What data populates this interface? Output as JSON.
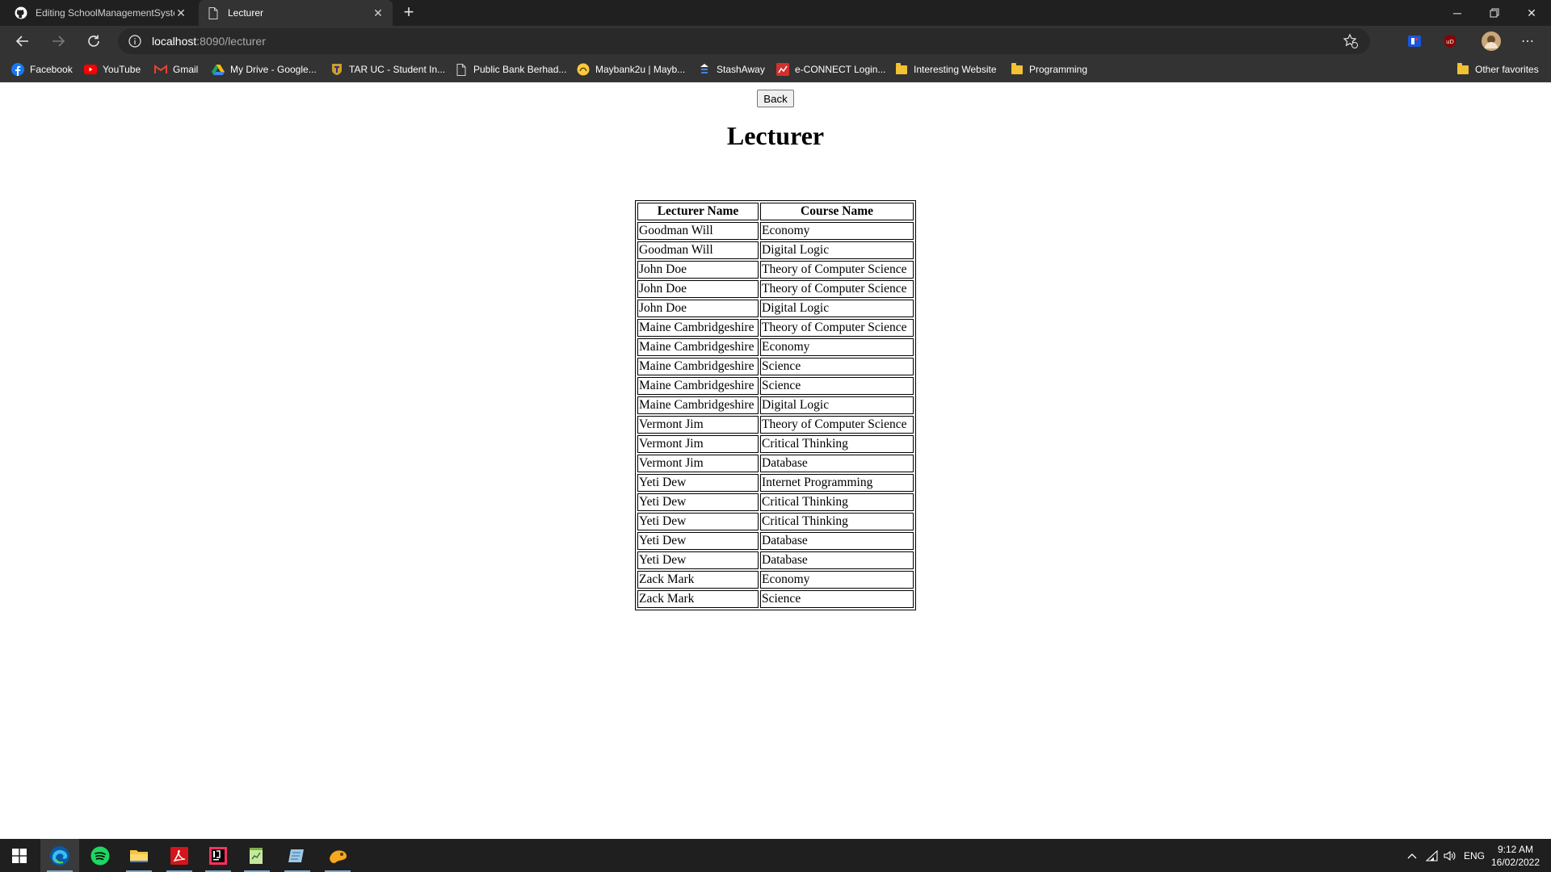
{
  "browser": {
    "tabs": [
      {
        "title": "Editing SchoolManagementSyste",
        "active": false
      },
      {
        "title": "Lecturer",
        "active": true
      }
    ],
    "address": {
      "host": "localhost",
      "rest": ":8090/lecturer"
    },
    "bookmarks": [
      {
        "label": "Facebook",
        "icon": "facebook-icon"
      },
      {
        "label": "YouTube",
        "icon": "youtube-icon"
      },
      {
        "label": "Gmail",
        "icon": "gmail-icon"
      },
      {
        "label": "My Drive - Google...",
        "icon": "drive-icon"
      },
      {
        "label": "TAR UC - Student In...",
        "icon": "tarc-icon"
      },
      {
        "label": "Public Bank Berhad...",
        "icon": "page-icon"
      },
      {
        "label": "Maybank2u | Mayb...",
        "icon": "maybank-icon"
      },
      {
        "label": "StashAway",
        "icon": "stashaway-icon"
      },
      {
        "label": "e-CONNECT Login...",
        "icon": "econnect-icon"
      },
      {
        "label": "Interesting Website",
        "icon": "folder-icon"
      },
      {
        "label": "Programming",
        "icon": "folder-icon"
      },
      {
        "label": "Other favorites",
        "icon": "folder-icon"
      }
    ]
  },
  "page": {
    "back_label": "Back",
    "title": "Lecturer",
    "table": {
      "headers": [
        "Lecturer Name",
        "Course Name"
      ],
      "rows": [
        [
          "Goodman Will",
          "Economy"
        ],
        [
          "Goodman Will",
          "Digital Logic"
        ],
        [
          "John Doe",
          "Theory of Computer Science"
        ],
        [
          "John Doe",
          "Theory of Computer Science"
        ],
        [
          "John Doe",
          "Digital Logic"
        ],
        [
          "Maine Cambridgeshire",
          "Theory of Computer Science"
        ],
        [
          "Maine Cambridgeshire",
          "Economy"
        ],
        [
          "Maine Cambridgeshire",
          "Science"
        ],
        [
          "Maine Cambridgeshire",
          "Science"
        ],
        [
          "Maine Cambridgeshire",
          "Digital Logic"
        ],
        [
          "Vermont Jim",
          "Theory of Computer Science"
        ],
        [
          "Vermont Jim",
          "Critical Thinking"
        ],
        [
          "Vermont Jim",
          "Database"
        ],
        [
          "Yeti Dew",
          "Internet Programming"
        ],
        [
          "Yeti Dew",
          "Critical Thinking"
        ],
        [
          "Yeti Dew",
          "Critical Thinking"
        ],
        [
          "Yeti Dew",
          "Database"
        ],
        [
          "Yeti Dew",
          "Database"
        ],
        [
          "Zack Mark",
          "Economy"
        ],
        [
          "Zack Mark",
          "Science"
        ]
      ]
    }
  },
  "taskbar": {
    "apps": [
      "windows-start-icon",
      "edge-icon",
      "spotify-icon",
      "file-explorer-icon",
      "acrobat-icon",
      "intellij-icon",
      "notepadpp-icon",
      "notepad-icon",
      "app-icon"
    ],
    "language": "ENG",
    "time": "9:12 AM",
    "date": "16/02/2022"
  },
  "colors": {
    "chrome_dark": "#202020",
    "toolbar": "#333333",
    "taskbar": "#1f1f1f"
  }
}
